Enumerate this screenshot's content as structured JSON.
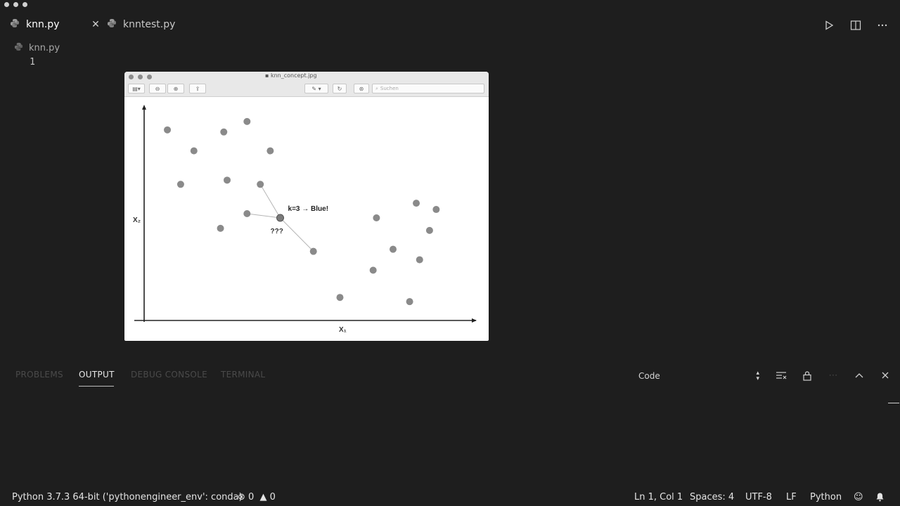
{
  "tabs": [
    {
      "label": "knn.py",
      "active": true,
      "close": "✕"
    },
    {
      "label": "knntest.py",
      "active": false
    }
  ],
  "breadcrumb": {
    "file": "knn.py"
  },
  "editor": {
    "line_numbers": [
      "1"
    ]
  },
  "viewer": {
    "title": "knn_concept.jpg",
    "search_placeholder": "Suchen",
    "chart_data": {
      "type": "scatter",
      "xlabel": "X₁",
      "ylabel": "X₂",
      "xlim": [
        0,
        100
      ],
      "ylim": [
        0,
        100
      ],
      "grid": false,
      "points": [
        {
          "x": 7,
          "y": 91
        },
        {
          "x": 15,
          "y": 81
        },
        {
          "x": 24,
          "y": 90
        },
        {
          "x": 31,
          "y": 95
        },
        {
          "x": 38,
          "y": 81
        },
        {
          "x": 11,
          "y": 65
        },
        {
          "x": 25,
          "y": 67
        },
        {
          "x": 35,
          "y": 65
        },
        {
          "x": 31,
          "y": 51
        },
        {
          "x": 23,
          "y": 44
        },
        {
          "x": 51,
          "y": 33
        },
        {
          "x": 59,
          "y": 11
        },
        {
          "x": 70,
          "y": 49
        },
        {
          "x": 69,
          "y": 24
        },
        {
          "x": 75,
          "y": 34
        },
        {
          "x": 82,
          "y": 56
        },
        {
          "x": 88,
          "y": 53
        },
        {
          "x": 86,
          "y": 43
        },
        {
          "x": 83,
          "y": 29
        },
        {
          "x": 80,
          "y": 9
        }
      ],
      "query_point": {
        "x": 41,
        "y": 49
      },
      "neighbors": [
        {
          "x": 35,
          "y": 65
        },
        {
          "x": 31,
          "y": 51
        },
        {
          "x": 51,
          "y": 33
        }
      ],
      "annotations": {
        "result": "k=3 → Blue!",
        "unknown": "???"
      }
    }
  },
  "panel": {
    "tabs": [
      "PROBLEMS",
      "OUTPUT",
      "DEBUG CONSOLE",
      "TERMINAL"
    ],
    "active_tab": "OUTPUT",
    "channel": "Code"
  },
  "status": {
    "interpreter": "Python 3.7.3 64-bit ('pythonengineer_env': conda)",
    "errors": "0",
    "warnings": "0",
    "position": "Ln 1, Col 1",
    "indent": "Spaces: 4",
    "encoding": "UTF-8",
    "eol": "LF",
    "language": "Python"
  },
  "icons": {
    "file": "python-file-icon",
    "run": "run-icon",
    "split": "split-editor-icon",
    "more": "more-actions-icon"
  }
}
